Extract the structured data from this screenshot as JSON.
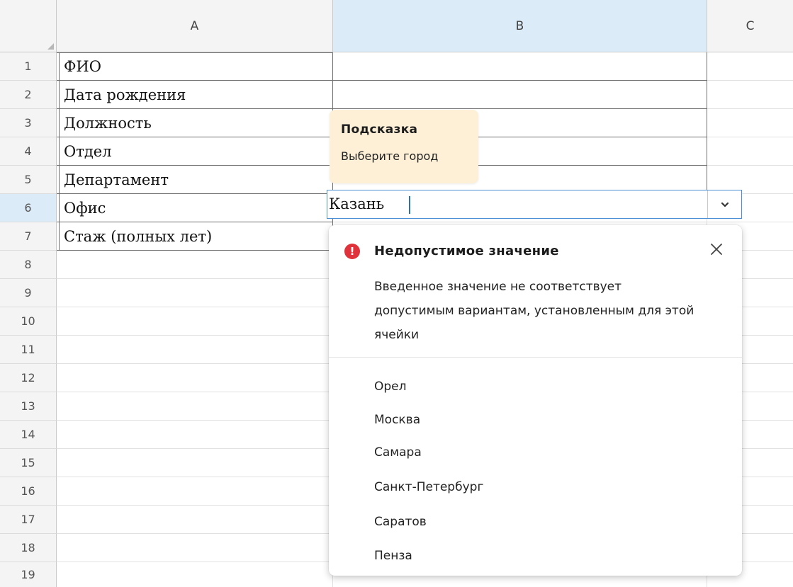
{
  "columns": [
    "A",
    "B",
    "C"
  ],
  "rows": [
    "1",
    "2",
    "3",
    "4",
    "5",
    "6",
    "7",
    "8",
    "9",
    "10",
    "11",
    "12",
    "13",
    "14",
    "15",
    "16",
    "17",
    "18",
    "19"
  ],
  "column_a": [
    "ФИО",
    "Дата рождения",
    "Должность",
    "Отдел",
    "Департамент",
    "Офис",
    "Стаж (полных лет)"
  ],
  "active_cell": {
    "value": "Казань",
    "dropdown_icon": "chevron-down-icon"
  },
  "hint": {
    "title": "Подсказка",
    "text": "Выберите город"
  },
  "error_popup": {
    "icon": "error-icon",
    "title": "Недопустимое значение",
    "message": "Введенное значение не соответствует допустимым вариантам, установленным для этой ячейки",
    "close_icon": "close-icon",
    "options": [
      "Орел",
      "Москва",
      "Самара",
      "Санкт-Петербург",
      "Саратов",
      "Пенза"
    ]
  },
  "colors": {
    "header_bg": "#f4f4f4",
    "selected_header_bg": "#dcebf8",
    "active_border": "#4a8fd4",
    "hint_bg": "#fdf0d7",
    "error_red": "#e0323a"
  }
}
